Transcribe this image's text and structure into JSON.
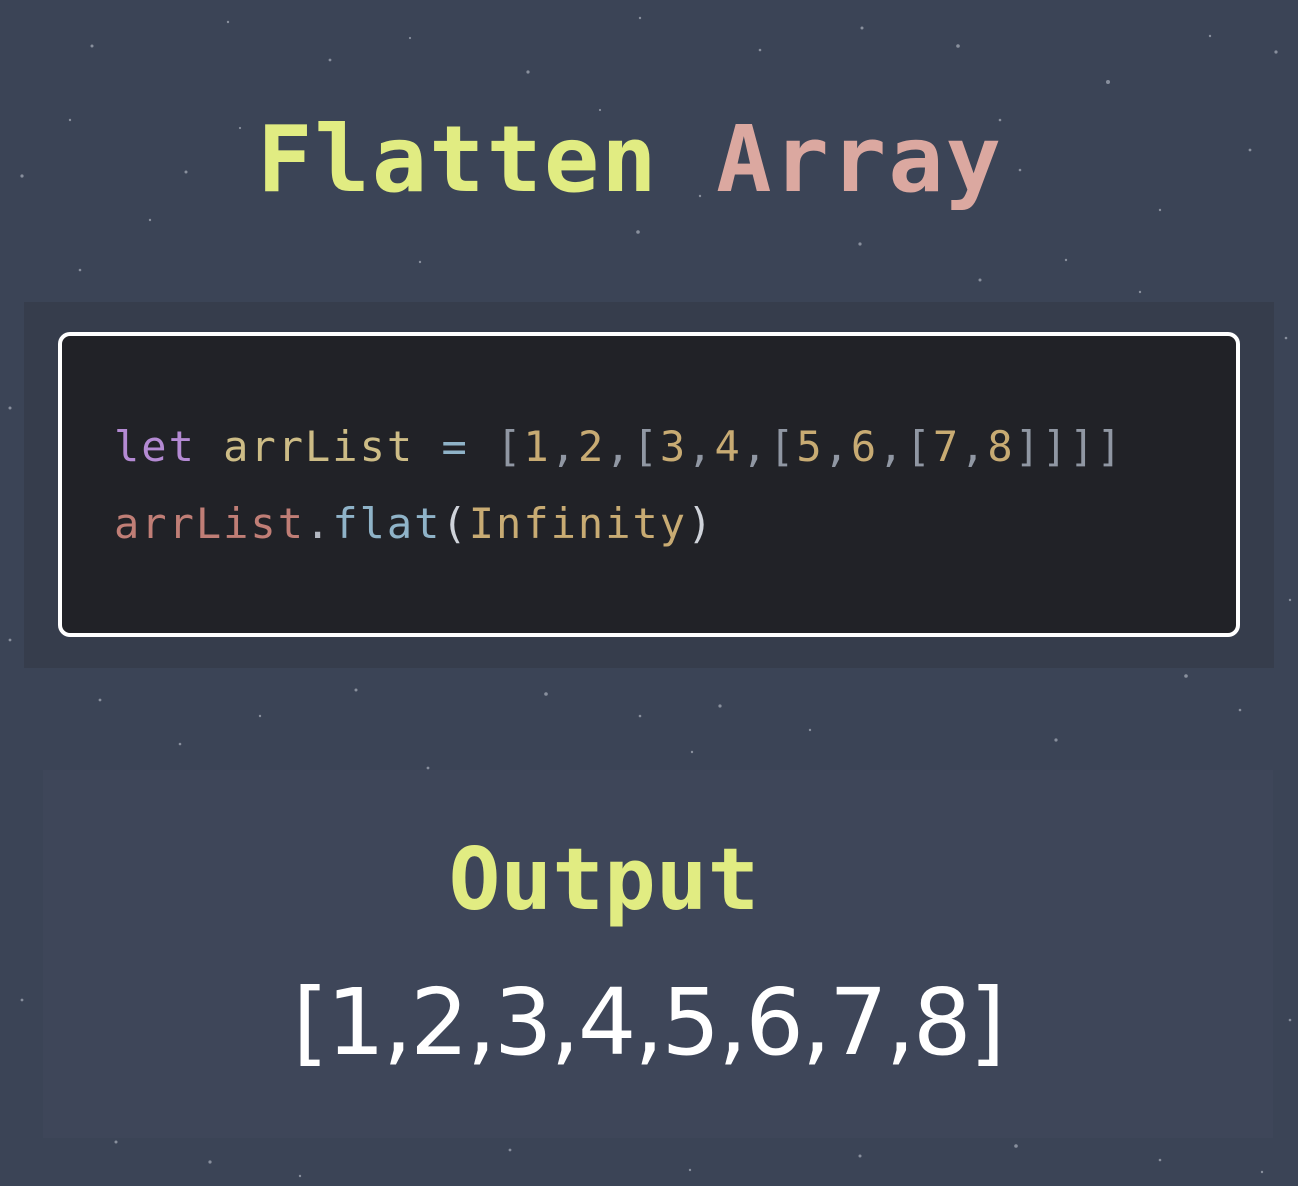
{
  "title": {
    "word1": "Flatten",
    "word2": "Array"
  },
  "code": {
    "line1": {
      "keyword": "let",
      "name": "arrList",
      "operator": "=",
      "open": "[",
      "n1": "1",
      "c1": ",",
      "n2": "2",
      "c2": ",",
      "open2": "[",
      "n3": "3",
      "c3": ",",
      "n4": "4",
      "c4": ",",
      "open3": "[",
      "n5": "5",
      "c5": ",",
      "n6": "6",
      "c6": ",",
      "open4": "[",
      "n7": "7",
      "c7": ",",
      "n8": "8",
      "close": "]]]]"
    },
    "line2": {
      "object": "arrList",
      "dot": ".",
      "method": "flat",
      "lparen": "(",
      "argument": "Infinity",
      "rparen": ")"
    }
  },
  "output": {
    "label": "Output",
    "value": "[1,2,3,4,5,6,7,8]"
  },
  "colors": {
    "background": "#3b4456",
    "title_word1": "#e1ec82",
    "title_word2": "#dba8a0",
    "code_background": "#212227"
  }
}
